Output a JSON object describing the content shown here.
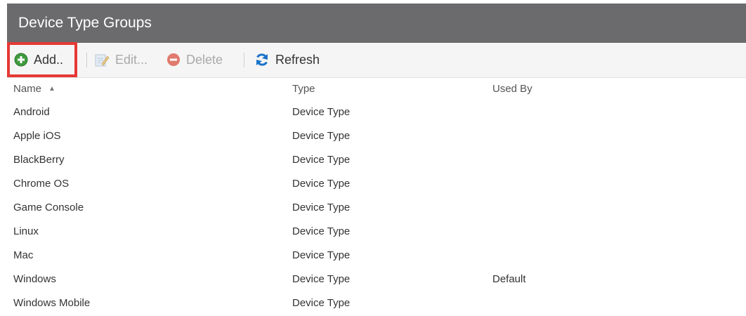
{
  "panel": {
    "title": "Device Type Groups"
  },
  "toolbar": {
    "add_label": "Add..",
    "edit_label": "Edit...",
    "delete_label": "Delete",
    "refresh_label": "Refresh"
  },
  "icons": {
    "add": "add-circle-icon",
    "edit": "edit-icon",
    "delete": "delete-circle-icon",
    "refresh": "refresh-icon",
    "sort": "sort-ascending-icon"
  },
  "colors": {
    "title_bar": "#6b6a6c",
    "add_green": "#3f9b3f",
    "delete_red": "#e07a6e",
    "refresh_blue": "#1a73c9",
    "highlight": "#e53935"
  },
  "table": {
    "columns": {
      "name": "Name",
      "type": "Type",
      "used_by": "Used By"
    },
    "rows": [
      {
        "name": "Android",
        "type": "Device Type",
        "used_by": ""
      },
      {
        "name": "Apple iOS",
        "type": "Device Type",
        "used_by": ""
      },
      {
        "name": "BlackBerry",
        "type": "Device Type",
        "used_by": ""
      },
      {
        "name": "Chrome OS",
        "type": "Device Type",
        "used_by": ""
      },
      {
        "name": "Game Console",
        "type": "Device Type",
        "used_by": ""
      },
      {
        "name": "Linux",
        "type": "Device Type",
        "used_by": ""
      },
      {
        "name": "Mac",
        "type": "Device Type",
        "used_by": ""
      },
      {
        "name": "Windows",
        "type": "Device Type",
        "used_by": "Default"
      },
      {
        "name": "Windows Mobile",
        "type": "Device Type",
        "used_by": ""
      }
    ]
  }
}
